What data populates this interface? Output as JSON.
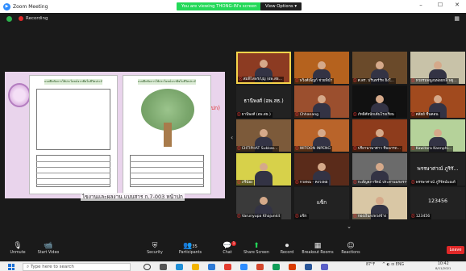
{
  "window": {
    "title": "Zoom Meeting"
  },
  "banner": {
    "share_text": "You are viewing THONG-IN's screen",
    "view_options": "View Options",
    "view_options_caret": "▾"
  },
  "window_controls": {
    "minimize": "–",
    "maximize": "☐",
    "close": "✕"
  },
  "status": {
    "recording": "Recording",
    "gallery_view": "▦"
  },
  "shared_screen": {
    "page_title_left": "แบบฝึกหัดการใช้ประโยชน์จากพืชในชีวิตประจำวัน",
    "page_title_right": "แบบฝึกหัดการใช้ประโยชน์จากพืชในชีวิตประจำวัน",
    "red_fragment": "ปก)",
    "caption": "ไขงานและผลงาน แบบสาร ก.7-003 หน้าปก"
  },
  "participants": [
    {
      "name": "สมพิไลพร/บุญ (อพ.สธ...",
      "muted": true,
      "active": true,
      "bg": "#8c3b22"
    },
    {
      "name": "พวิงศ์เพ็ญก์ ช่วยพินำ",
      "muted": true,
      "active": false,
      "bg": "#b5621e"
    },
    {
      "name": "ศ.ดร. ปรินทร์ร์ท ยิ่งใ...",
      "muted": true,
      "active": false,
      "bg": "#6a4a2a"
    },
    {
      "name": "ทวยรมพนูงนพ่อยกลิ่ พยุ...",
      "muted": true,
      "active": false,
      "bg": "#c8c2a8"
    },
    {
      "name": "ธานีพงศ์ (อพ.สธ.)",
      "muted": true,
      "active": false,
      "bg": "#222222",
      "display": "ธานีพงศ์ (อพ.สธ.)"
    },
    {
      "name": "Chhanang",
      "muted": true,
      "active": false,
      "bg": "#9b4f2e"
    },
    {
      "name": "ภัทธิศัยนักเต้นโรงเรียน",
      "muted": true,
      "active": false,
      "bg": "#111111"
    },
    {
      "name": "ศลัยย์ ชื่นคอน",
      "muted": true,
      "active": false,
      "bg": "#a14a1e"
    },
    {
      "name": "CHTIPHAT Sukkas...",
      "muted": true,
      "active": false,
      "bg": "#7c5a3a"
    },
    {
      "name": "WITOON INPENG",
      "muted": true,
      "active": false,
      "bg": "#b9642a"
    },
    {
      "name": "ปรียานานาศาว ชินนารถ...",
      "muted": true,
      "active": false,
      "bg": "#8e3c1c"
    },
    {
      "name": "Kawitara Kaenphi...",
      "muted": true,
      "active": false,
      "bg": "#b5d29a"
    },
    {
      "name": "ภรีน้อง",
      "muted": true,
      "active": false,
      "bg": "#d7d14a"
    },
    {
      "name": "กวลพน - คงวงพย",
      "muted": true,
      "active": false,
      "bg": "#5a2b1a"
    },
    {
      "name": "กะสัญสภารัตน์ ประสานนรอรรายง",
      "muted": true,
      "active": false,
      "bg": "#6b6b6b"
    },
    {
      "name": "พรรษาศาณ์ ภูริรัตน์บณท์",
      "muted": true,
      "active": false,
      "bg": "#222222",
      "display": "พรรษาศาณ์ ภูริรั..."
    },
    {
      "name": "Varunyupa Khajunkit",
      "muted": true,
      "active": false,
      "bg": "#3a3a3a"
    },
    {
      "name": "แซ็ก",
      "muted": true,
      "active": false,
      "bg": "#222222",
      "display": "แซ็ก"
    },
    {
      "name": "กองเงินกงพวงข้าง",
      "muted": true,
      "active": false,
      "bg": "#d9c7a5"
    },
    {
      "name": "123456",
      "muted": true,
      "active": false,
      "bg": "#222222",
      "display": "123456"
    }
  ],
  "gallery_caret": "⌄",
  "side_caret": "‹",
  "toolbar": {
    "unmute": "Unmute",
    "start_video": "Start Video",
    "security": "Security",
    "participants": "Participants",
    "participants_count": "35",
    "chat": "Chat",
    "chat_badge": "1",
    "share_screen": "Share Screen",
    "record": "Record",
    "breakout_rooms": "Breakout Rooms",
    "reactions": "Reactions",
    "leave": "Leave"
  },
  "taskbar": {
    "search_placeholder": "Type here to search",
    "weather": "87°F",
    "clock_time": "10:42",
    "clock_date": "8/11/2021",
    "tray_icons": "^ ◐ ⊡ ENG"
  }
}
